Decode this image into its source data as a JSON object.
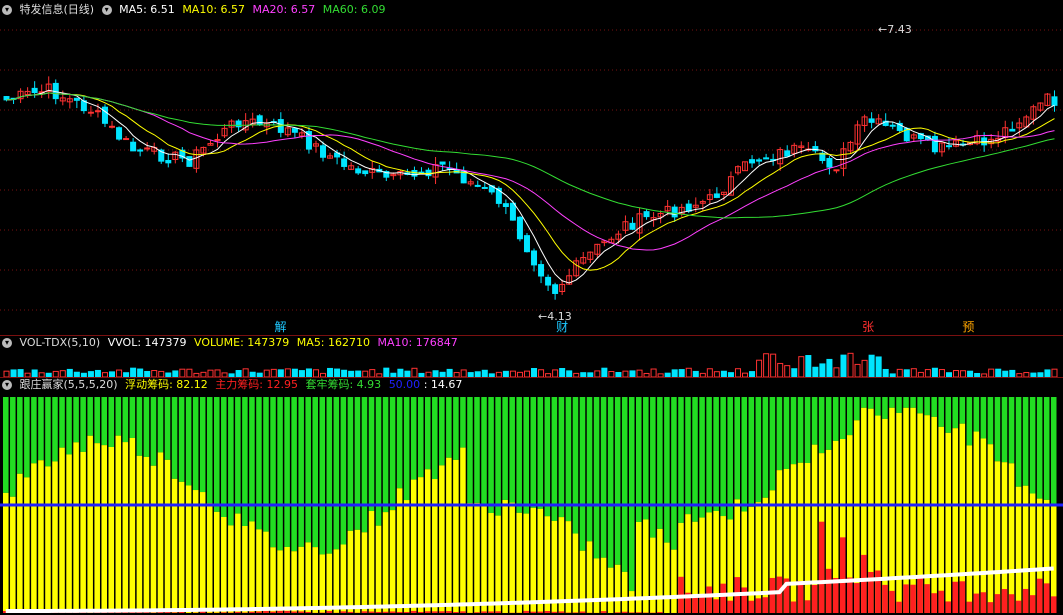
{
  "price": {
    "title": "特发信息(日线)",
    "ma": [
      {
        "label": "MA5: 6.51",
        "color": "#ffffff"
      },
      {
        "label": "MA10: 6.57",
        "color": "#ffff00"
      },
      {
        "label": "MA20: 6.57",
        "color": "#ff40ff"
      },
      {
        "label": "MA60: 6.09",
        "color": "#33dd33"
      }
    ],
    "high_label": "7.43",
    "low_label": "4.13",
    "markers": [
      {
        "text": "解",
        "pos": 0.263,
        "color": "#1ec8ff"
      },
      {
        "text": "财",
        "pos": 0.53,
        "color": "#1ec8ff"
      },
      {
        "text": "张",
        "pos": 0.82,
        "color": "#ff3030"
      },
      {
        "text": "预",
        "pos": 0.915,
        "color": "#ffa500"
      }
    ]
  },
  "volume": {
    "indicator": "VOL-TDX(5,10)",
    "items": [
      {
        "label": "VVOL: 147379",
        "color": "#ffffff"
      },
      {
        "label": "VOLUME: 147379",
        "color": "#ffff00"
      },
      {
        "label": "MA5: 162710",
        "color": "#ffff00"
      },
      {
        "label": "MA10: 176847",
        "color": "#ff40ff"
      }
    ]
  },
  "chips": {
    "indicator": "跟庄赢家(5,5,5,20)",
    "items": [
      {
        "label": "浮动筹码: 82.12",
        "color": "#ffff00"
      },
      {
        "label": "主力筹码: 12.95",
        "color": "#ff2020"
      },
      {
        "label": "套牢筹码: 4.93",
        "color": "#33dd33"
      },
      {
        "label": "50.00",
        "color": "#2020ff"
      },
      {
        "label": ": 14.67",
        "color": "#ffffff"
      }
    ]
  },
  "colors": {
    "up": "#ff3232",
    "down": "#00e5ff",
    "grid": "#7a1010",
    "ma5": "#ffffff",
    "ma10": "#ffff00",
    "ma20": "#ff40ff",
    "ma60": "#33dd33"
  }
}
